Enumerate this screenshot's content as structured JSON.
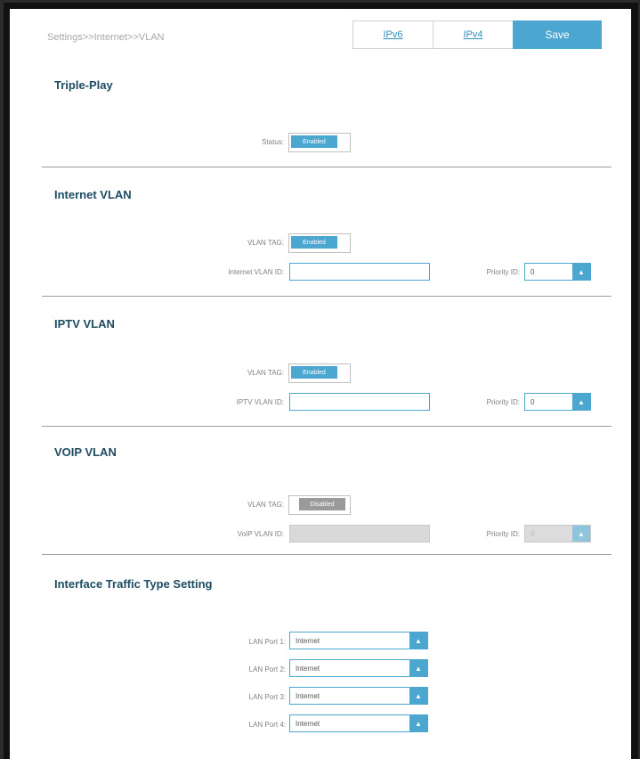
{
  "breadcrumb": "Settings>>Internet>>VLAN",
  "toolbar": {
    "ipv6_label": "IPv6",
    "ipv4_label": "IPv4",
    "save_label": "Save"
  },
  "triple_play": {
    "title": "Triple-Play",
    "status_label": "Status:",
    "status_value": "Enabled"
  },
  "internet_vlan": {
    "title": "Internet VLAN",
    "tag_label": "VLAN TAG:",
    "tag_value": "Enabled",
    "id_label": "Internet VLAN ID:",
    "id_value": "",
    "priority_label": "Priority ID:",
    "priority_value": "0"
  },
  "iptv_vlan": {
    "title": "IPTV VLAN",
    "tag_label": "VLAN TAG:",
    "tag_value": "Enabled",
    "id_label": "IPTV VLAN ID:",
    "id_value": "",
    "priority_label": "Priority ID:",
    "priority_value": "0"
  },
  "voip_vlan": {
    "title": "VOIP VLAN",
    "tag_label": "VLAN TAG:",
    "tag_value": "Disabled",
    "id_label": "VoIP VLAN ID:",
    "id_value": "",
    "priority_label": "Priority ID:",
    "priority_value": "0"
  },
  "interface_traffic": {
    "title": "Interface Traffic Type Setting",
    "ports": [
      {
        "label": "LAN Port 1:",
        "value": "Internet"
      },
      {
        "label": "LAN Port 2:",
        "value": "Internet"
      },
      {
        "label": "LAN Port 3:",
        "value": "Internet"
      },
      {
        "label": "LAN Port 4:",
        "value": "Internet"
      }
    ]
  },
  "icons": {
    "dropdown": "chevron-down-icon"
  },
  "colors": {
    "accent": "#4ba6d0",
    "title": "#1d4c62",
    "disabled": "#9a9a9a"
  }
}
